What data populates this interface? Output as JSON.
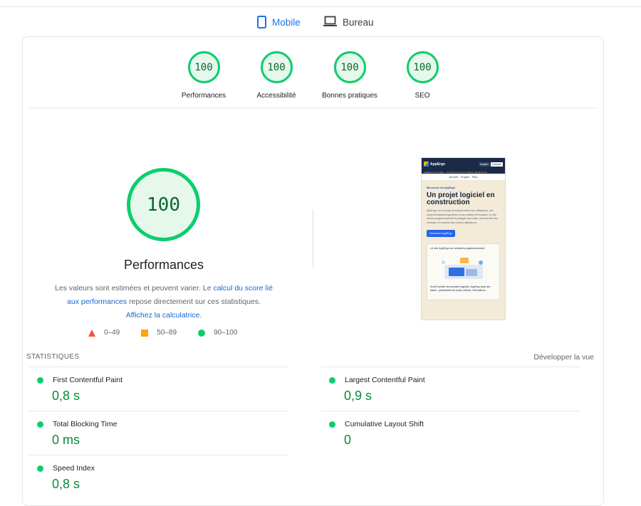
{
  "tabs": [
    {
      "label": "Mobile",
      "icon": "phone-icon",
      "active": true
    },
    {
      "label": "Bureau",
      "icon": "laptop-icon",
      "active": false
    }
  ],
  "categories": [
    {
      "score": "100",
      "label": "Performances"
    },
    {
      "score": "100",
      "label": "Accessibilité"
    },
    {
      "score": "100",
      "label": "Bonnes pratiques"
    },
    {
      "score": "100",
      "label": "SEO"
    }
  ],
  "main": {
    "score": "100",
    "title": "Performances",
    "desc_part1": "Les valeurs sont estimées et peuvent varier. Le ",
    "desc_link1": "calcul du score lié aux performances",
    "desc_part2": " repose directement sur ces statistiques. ",
    "desc_link2": "Affichez la calculatrice",
    "desc_part3": "."
  },
  "legend": [
    {
      "range": "0–49",
      "color": "#ff4e42",
      "shape": "triangle"
    },
    {
      "range": "50–89",
      "color": "#ffa400",
      "shape": "square"
    },
    {
      "range": "90–100",
      "color": "#0cce6b",
      "shape": "circle"
    }
  ],
  "thumbnail": {
    "brand": "AppErgo",
    "lang_a": "English",
    "lang_b": "Français",
    "banner": "AppErgo est en ligne — les annonces sont corrigées régulièrement",
    "menu": [
      "Accueil",
      "Projets",
      "FAQ"
    ],
    "kicker": "Bienvenue sur AppErgo",
    "heading": "Un projet logiciel en construction",
    "paragraph": "AppErgo est un projet personnel dédié aux utilisateurs, aux expérimentations logicielles et aux articles techniques. Le site servira progressivement à partager des outils, documenter leur évolution et recueillir des retours utilisateurs.",
    "cta": "Découvrir AppErgo",
    "panel_title": "Le site AppErgo se construit progressivement",
    "panel_footer": "Avant l'arrivée des premiers logiciels, AppErgo pose ses bases : présentation du projet, articles, informations"
  },
  "stats": {
    "heading": "STATISTIQUES",
    "expand": "Développer la vue",
    "metrics": [
      {
        "name": "First Contentful Paint",
        "value": "0,8 s"
      },
      {
        "name": "Largest Contentful Paint",
        "value": "0,9 s"
      },
      {
        "name": "Total Blocking Time",
        "value": "0 ms"
      },
      {
        "name": "Cumulative Layout Shift",
        "value": "0"
      },
      {
        "name": "Speed Index",
        "value": "0,8 s"
      }
    ]
  },
  "colors": {
    "accent": "#1a73e8",
    "pass": "#0cce6b",
    "pass_text": "#0a8a3a"
  }
}
